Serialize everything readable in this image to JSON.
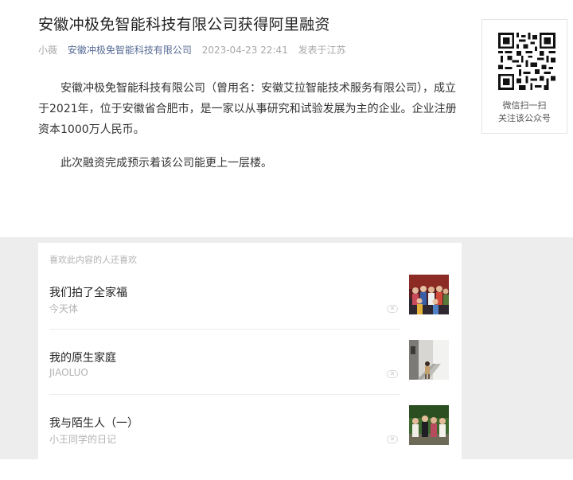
{
  "article": {
    "title": "安徽冲极免智能科技有限公司获得阿里融资",
    "author": "小薇",
    "account": "安徽冲极免智能科技有限公司",
    "datetime": "2023-04-23 22:41",
    "location": "发表于江苏",
    "paragraphs": [
      "安徽冲极免智能科技有限公司（曾用名：安徽艾拉智能技术服务有限公司），成立于2021年，位于安徽省合肥市，是一家以从事研究和试验发展为主的企业。企业注册资本1000万人民币。",
      "此次融资完成预示着该公司能更上一层楼。"
    ]
  },
  "qr": {
    "line1": "微信扫一扫",
    "line2": "关注该公众号",
    "icon": "qr-code-icon"
  },
  "recommend": {
    "header": "喜欢此内容的人还喜欢",
    "items": [
      {
        "title": "我们拍了全家福",
        "source": "今天体",
        "thumb": "family-photo"
      },
      {
        "title": "我的原生家庭",
        "source": "JIAOLUO",
        "thumb": "stairway-photo"
      },
      {
        "title": "我与陌生人（一）",
        "source": "小王同学的日记",
        "thumb": "group-photo"
      }
    ],
    "close_glyph": "✕"
  },
  "colors": {
    "account_link": "#576b95",
    "meta_gray": "#a8a8a8",
    "page_bg_gray": "#ededed"
  }
}
